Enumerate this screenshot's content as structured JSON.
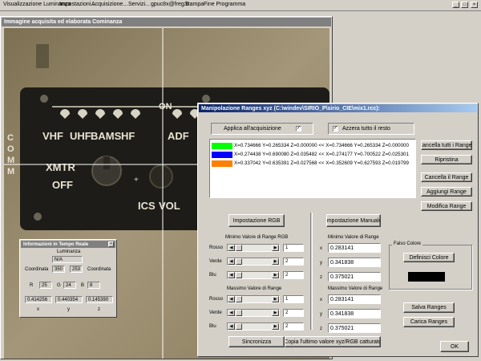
{
  "app": {
    "menu": [
      "Visualizzazione Luminanza",
      "Impostazioni...",
      "Acquisizione...",
      "Servizi...",
      "gpuc8x@freg.it",
      "Stampa",
      "Fine Programma"
    ]
  },
  "image_window": {
    "title": "Immagine acquisita ed elaborata Cominanza",
    "panel_text": {
      "on": "ON",
      "vhf": "VHF",
      "uhf": "UHF",
      "bams": "BAMS",
      "hf": "HF",
      "adf": "ADF",
      "xmtr": "XMTR",
      "off": "OFF",
      "ics": "ICS",
      "vol": "VOL",
      "comm": "C\nO\nM\nM"
    }
  },
  "info_window": {
    "title": "Informazioni in Tempo Reale",
    "luminance_label": "Luminanza",
    "luminance_value": "N/A",
    "coord_label_left": "Coordinata",
    "coord_label_right": "Coordinata",
    "coord_x": "350",
    "coord_y": "253",
    "r_label": "R",
    "r_value": "25",
    "g_label": "G",
    "g_value": "24",
    "b_label": "B",
    "b_value": "8",
    "x_value": "0.414256",
    "y_value": "0.440354",
    "z_value": "0.145390",
    "x_label": "x",
    "y_label": "y",
    "z_label": "z"
  },
  "dialog": {
    "title": "Manipolazione Ranges xyz (C:\\windev\\SIRIO_P\\sirio_CIE\\mix1.rcc):",
    "apply_label": "Applica all'acquisizione",
    "reset_label": "Azzera tutto il resto",
    "ranges": [
      {
        "color": "#00ff00",
        "text": "X=0.734666 Y=0.265334 Z=0.000000 << X=0.734666 Y=0.265334 Z=0.000000"
      },
      {
        "color": "#0000ff",
        "text": "X=0.274438 Y=0.690080 Z=0.035482 << X=0.274177 Y=0.700522 Z=0.025301"
      },
      {
        "color": "#ff8000",
        "text": "X=0.337042 Y=0.635391 Z=0.027568 << X=0.352609 Y=0.627593 Z=0.019799"
      }
    ],
    "btn_clear_all": "Cancella tutti i Ranges",
    "btn_restore": "Ripristina",
    "btn_delete_range": "Cancella il Range",
    "btn_add_range": "Aggiungi Range",
    "btn_modify_range": "Modifica Range",
    "btn_rgb_settings": "Impostazione RGB",
    "btn_manual_settings": "Impostazione Manuale",
    "min_rgb_label": "Minimo Valore di Range RGB",
    "max_rgb_label": "Massimo Valore di Range",
    "red": "Rosso",
    "green": "Verde",
    "blue": "Blu",
    "min_r": "1",
    "min_g": "2",
    "min_b": "2",
    "max_r": "1",
    "max_g": "2",
    "max_b": "2",
    "min_range_label": "Minimo Valore di Range",
    "max_range_label": "Massimo Valore di Range",
    "min_x": "0.283141",
    "min_y": "0.341838",
    "min_z": "0.375021",
    "max_x": "0.283141",
    "max_y": "0.341838",
    "max_z": "0.375021",
    "x": "x",
    "y": "y",
    "z": "z",
    "false_color_label": "Falso Colore",
    "btn_define_colors": "Definisci Colore",
    "btn_save_ranges": "Salva Ranges",
    "btn_load_ranges": "Carica Ranges",
    "btn_sync": "Sincronizza",
    "btn_copy_last": "Copia l'ultimo valore xyz/RGB catturato",
    "btn_ok": "OK"
  }
}
